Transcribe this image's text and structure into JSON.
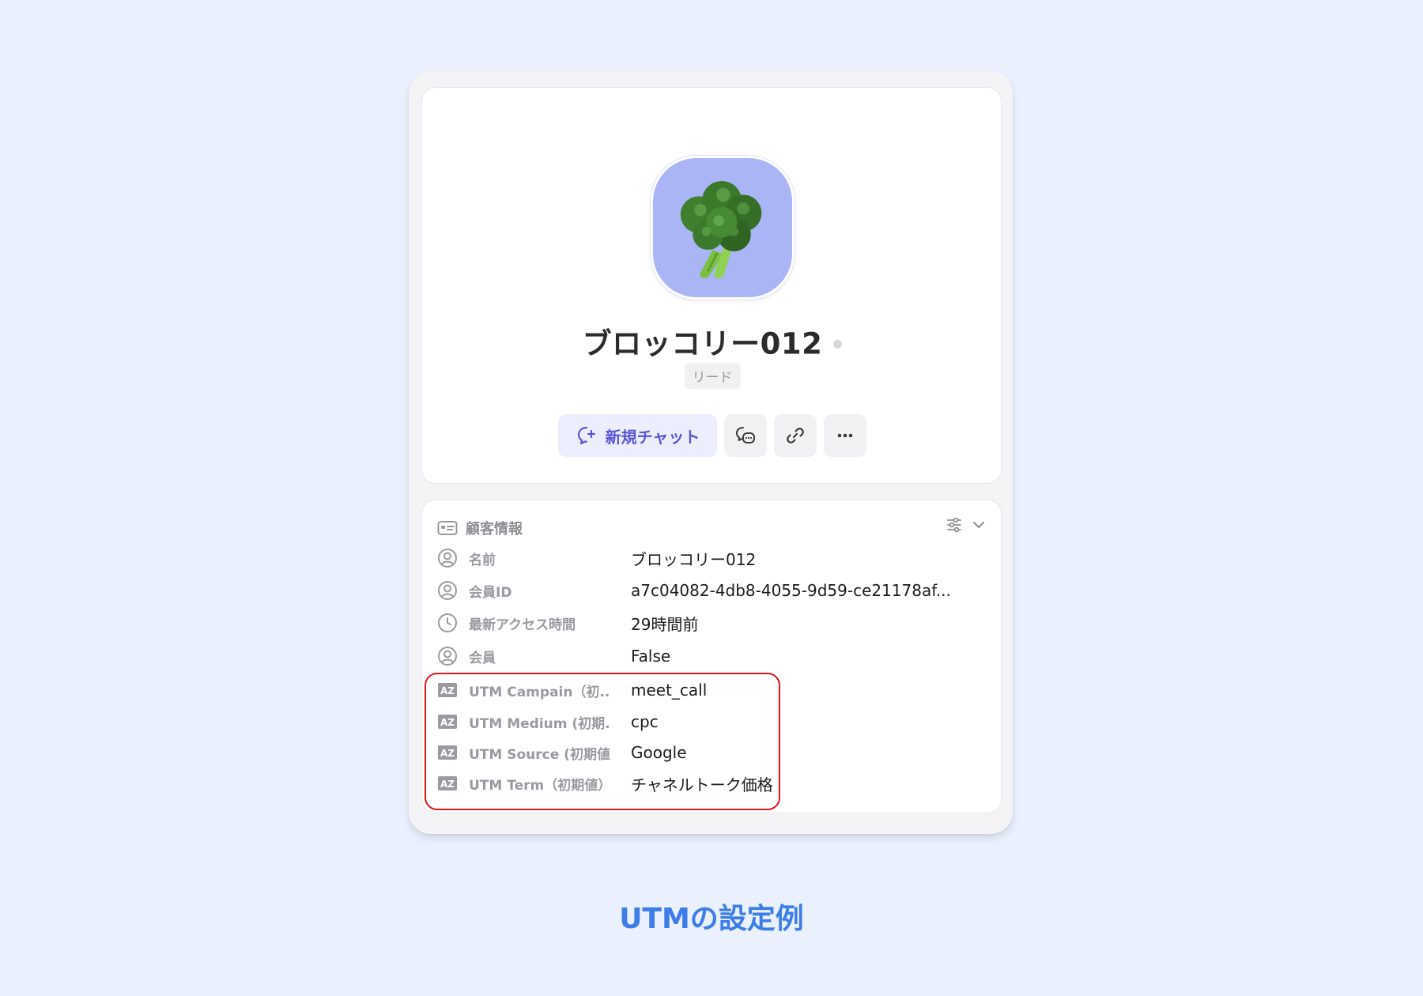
{
  "profile": {
    "name": "ブロッコリー012",
    "badge": "リード",
    "avatar_icon": "broccoli-icon",
    "avatar_bg": "#a9b5f5",
    "actions": {
      "new_chat_label": "新規チャット",
      "new_chat_icon": "chat-plus-icon",
      "chat_history_icon": "chat-bubbles-icon",
      "link_icon": "link-icon",
      "more_icon": "more-horizontal-icon"
    }
  },
  "customer_info": {
    "title": "顧客情報",
    "title_icon": "id-card-icon",
    "settings_icon": "sliders-icon",
    "collapse_icon": "chevron-down-icon",
    "fields": [
      {
        "icon": "user-icon",
        "label": "名前",
        "value": "ブロッコリー012"
      },
      {
        "icon": "user-icon",
        "label": "会員ID",
        "value": "a7c04082-4db8-4055-9d59-ce21178af..."
      },
      {
        "icon": "clock-icon",
        "label": "最新アクセス時間",
        "value": "29時間前"
      },
      {
        "icon": "user-icon",
        "label": "会員",
        "value": "False"
      },
      {
        "icon": "text-az-icon",
        "label": "UTM Campain（初...",
        "value": "meet_call"
      },
      {
        "icon": "text-az-icon",
        "label": "UTM Medium (初期...",
        "value": "cpc"
      },
      {
        "icon": "text-az-icon",
        "label": "UTM Source (初期値)",
        "value": "Google"
      },
      {
        "icon": "text-az-icon",
        "label": "UTM Term（初期値）",
        "value": "チャネルトーク価格"
      }
    ]
  },
  "highlight_color": "#e8141b",
  "caption": "UTMの設定例",
  "accent_color": "#5a55d6"
}
